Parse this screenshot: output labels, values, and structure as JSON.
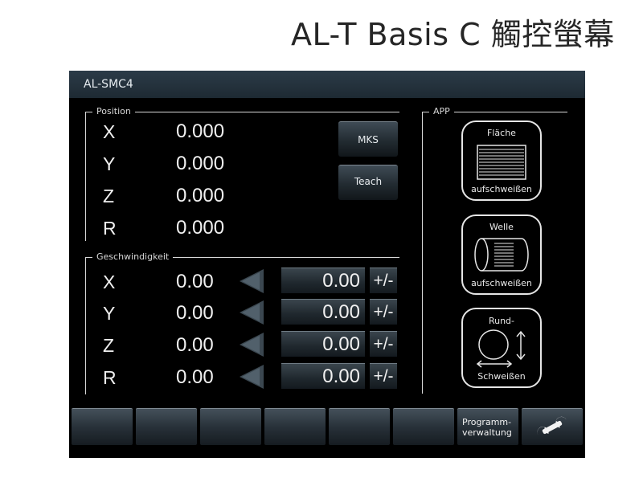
{
  "page_title": "AL-T Basis C 觸控螢幕",
  "window_title": "AL-SMC4",
  "position": {
    "label": "Position",
    "rows": [
      {
        "axis": "X",
        "value": "0.000"
      },
      {
        "axis": "Y",
        "value": "0.000"
      },
      {
        "axis": "Z",
        "value": "0.000"
      },
      {
        "axis": "R",
        "value": "0.000"
      }
    ],
    "mks_label": "MKS",
    "teach_label": "Teach"
  },
  "speed": {
    "label": "Geschwindigkeit",
    "rows": [
      {
        "axis": "X",
        "value": "0.00",
        "setpoint": "0.00",
        "sign": "+/-"
      },
      {
        "axis": "Y",
        "value": "0.00",
        "setpoint": "0.00",
        "sign": "+/-"
      },
      {
        "axis": "Z",
        "value": "0.00",
        "setpoint": "0.00",
        "sign": "+/-"
      },
      {
        "axis": "R",
        "value": "0.00",
        "setpoint": "0.00",
        "sign": "+/-"
      }
    ]
  },
  "app": {
    "label": "APP",
    "buttons": [
      {
        "top": "Fläche",
        "bottom": "aufschweißen",
        "icon": "surface-hatch-icon"
      },
      {
        "top": "Welle",
        "bottom": "aufschweißen",
        "icon": "shaft-icon"
      },
      {
        "top": "Rund-",
        "bottom": "Schweißen",
        "icon": "round-weld-icon"
      }
    ]
  },
  "footer": {
    "program_label_1": "Programm-",
    "program_label_2": "verwaltung",
    "settings_icon": "wrench-icon"
  },
  "colors": {
    "background": "#000000",
    "titlebar": "#1e2a33",
    "text": "#f0f0f0"
  }
}
